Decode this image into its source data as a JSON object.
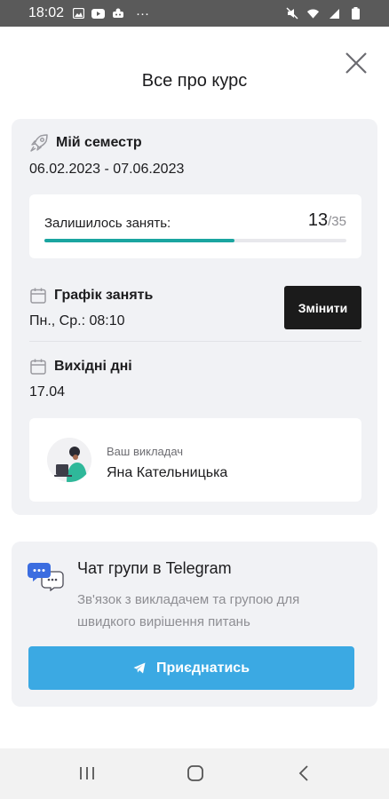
{
  "status_bar": {
    "time": "18:02",
    "more": "···"
  },
  "header": {
    "title": "Все про курс"
  },
  "semester": {
    "title": "Мій семестр",
    "dates": "06.02.2023 - 07.06.2023",
    "progress_label": "Залишилось занять:",
    "remaining": "13",
    "total": "/35",
    "progress_fraction": 0.63,
    "progress_color": "#1aa5a0"
  },
  "schedule": {
    "title": "Графік занять",
    "value": "Пн., Ср.: 08:10",
    "change_label": "Змінити"
  },
  "holidays": {
    "title": "Вихідні дні",
    "value": "17.04"
  },
  "teacher": {
    "caption": "Ваш викладач",
    "name": "Яна Кательницька"
  },
  "chat": {
    "title": "Чат групи в Telegram",
    "description": "Зв'язок з викладачем та групою для швидкого вирішення питань",
    "join_label": "Приєднатись",
    "accent": "#3ba9e3"
  }
}
